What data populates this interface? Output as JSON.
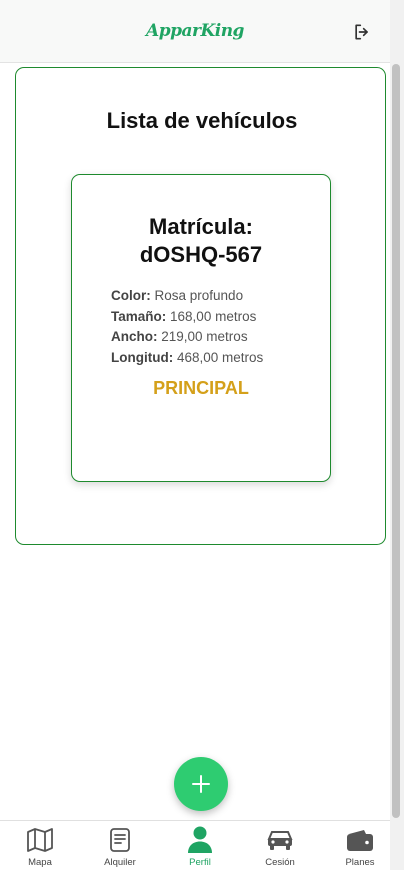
{
  "header": {
    "logo_text": "ApparKing",
    "logout_icon": "logout-icon"
  },
  "main": {
    "title": "Lista de vehículos",
    "vehicle": {
      "plate_label": "Matrícula:",
      "plate": "dOSHQ-567",
      "color_label": "Color:",
      "color_value": "Rosa profundo",
      "size_label": "Tamaño:",
      "size_value": "168,00 metros",
      "width_label": "Ancho:",
      "width_value": "219,00 metros",
      "length_label": "Longitud:",
      "length_value": "468,00 metros",
      "status": "PRINCIPAL"
    }
  },
  "fab": {
    "label": "+",
    "icon": "plus-icon"
  },
  "nav": {
    "items": [
      {
        "label": "Mapa",
        "icon": "map-icon"
      },
      {
        "label": "Alquiler",
        "icon": "document-icon"
      },
      {
        "label": "Perfil",
        "icon": "user-icon",
        "active": true
      },
      {
        "label": "Cesión",
        "icon": "car-icon"
      },
      {
        "label": "Planes",
        "icon": "wallet-icon"
      }
    ]
  },
  "colors": {
    "accent": "#1fa463",
    "border": "#1e8a2e",
    "status": "#d4a01a",
    "fab": "#2ecc71"
  }
}
